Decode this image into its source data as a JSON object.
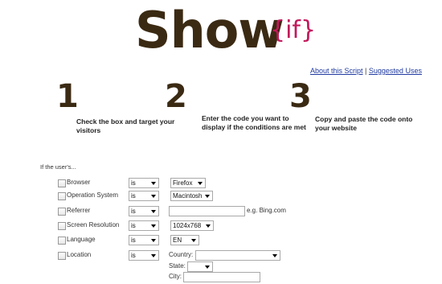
{
  "logo": {
    "main": "Show",
    "suffix": "{if}"
  },
  "links": {
    "about": "About this Script",
    "separator": "|",
    "uses": "Suggested Uses"
  },
  "steps": [
    {
      "number": "1",
      "text": "Check the box and target your visitors"
    },
    {
      "number": "2",
      "text": "Enter the code you want to display if the conditions are met"
    },
    {
      "number": "3",
      "text": "Copy and paste the code onto your website"
    }
  ],
  "form": {
    "intro": "If the user's...",
    "rows": [
      {
        "label": "Browser",
        "operator": "is",
        "value": "Firefox"
      },
      {
        "label": "Operation System",
        "operator": "is",
        "value": "Macintosh"
      },
      {
        "label": "Referrer",
        "operator": "is",
        "value": "",
        "hint": "e.g. Bing.com"
      },
      {
        "label": "Screen Resolution",
        "operator": "is",
        "value": "1024x768"
      },
      {
        "label": "Language",
        "operator": "is",
        "value": "EN"
      },
      {
        "label": "Location",
        "operator": "is",
        "country_label": "Country:",
        "country_value": "",
        "state_label": "State:",
        "state_value": "",
        "city_label": "City:",
        "city_value": ""
      }
    ]
  }
}
